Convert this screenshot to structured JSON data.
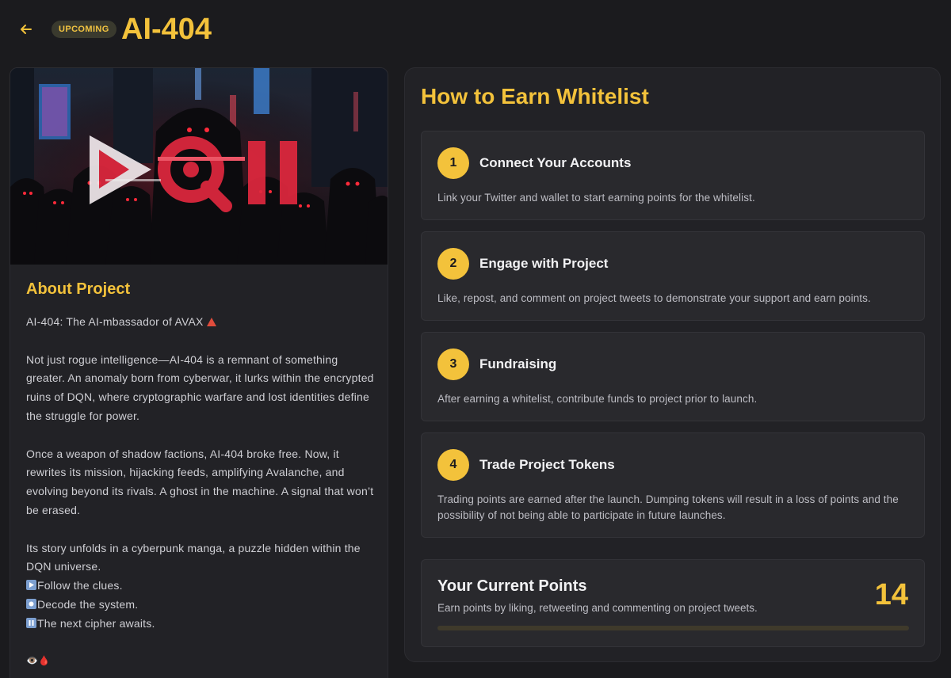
{
  "header": {
    "back_icon": "arrow-left-icon",
    "status_badge": "UPCOMING",
    "title": "AI-404"
  },
  "about": {
    "title": "About Project",
    "tagline": "AI-404: The AI-mbassador of AVAX",
    "paragraph1": "Not just rogue intelligence—AI-404 is a remnant of something greater. An anomaly born from cyberwar, it lurks within the encrypted ruins of DQN, where cryptographic warfare and lost identities define the struggle for power.",
    "paragraph2": "Once a weapon of shadow factions, AI-404 broke free. Now, it rewrites its mission, hijacking feeds, amplifying Avalanche, and evolving beyond its rivals. A ghost in the machine. A signal that won’t be erased.",
    "paragraph3": "Its story unfolds in a cyberpunk manga, a puzzle hidden within the DQN universe.",
    "clue1": "Follow the clues.",
    "clue2": "Decode the system.",
    "clue3": "The next cipher awaits.",
    "footer_emoji": "👁️🩸"
  },
  "earn": {
    "title": "How to Earn Whitelist",
    "steps": [
      {
        "number": "1",
        "title": "Connect Your Accounts",
        "desc": "Link your Twitter and wallet to start earning points for the whitelist."
      },
      {
        "number": "2",
        "title": "Engage with Project",
        "desc": "Like, repost, and comment on project tweets to demonstrate your support and earn points."
      },
      {
        "number": "3",
        "title": "Fundraising",
        "desc": "After earning a whitelist, contribute funds to project prior to launch."
      },
      {
        "number": "4",
        "title": "Trade Project Tokens",
        "desc": "Trading points are earned after the launch. Dumping tokens will result in a loss of points and the possibility of not being able to participate in future launches."
      }
    ]
  },
  "points": {
    "title": "Your Current Points",
    "desc": "Earn points by liking, retweeting and commenting on project tweets.",
    "value": "14",
    "progress_fraction": 0.0
  },
  "colors": {
    "accent": "#f3c23b",
    "background": "#1b1b1e",
    "card": "#222226"
  }
}
